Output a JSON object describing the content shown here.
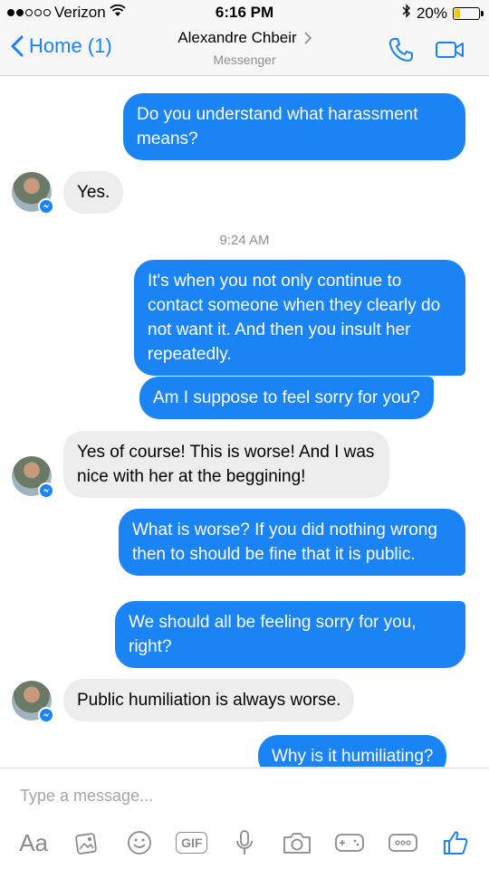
{
  "status_bar": {
    "carrier": "Verizon",
    "time": "6:16 PM",
    "battery": "20%",
    "battery_level": 0.2
  },
  "nav": {
    "back_label": "Home (1)",
    "contact_name": "Alexandre Chbeir",
    "subtitle": "Messenger"
  },
  "messages": [
    {
      "from": "me",
      "text": "Do you understand what harassment means?"
    },
    {
      "from": "them",
      "text": "Yes."
    },
    {
      "type": "timestamp",
      "text": "9:24 AM"
    },
    {
      "from": "me",
      "text": "It's when you not only continue to contact someone when they clearly do not want it.  And then you insult her repeatedly."
    },
    {
      "from": "me",
      "text": "Am I suppose to feel sorry for you?"
    },
    {
      "from": "them",
      "text": "Yes of course! This is worse! And I was nice with her at the beggining!"
    },
    {
      "from": "me",
      "text": "What is worse?  If you did nothing wrong then to should be fine that it is public."
    },
    {
      "from": "me",
      "text": "We should all be feeling sorry for you, right?"
    },
    {
      "from": "them",
      "text": "Public humiliation is always worse."
    },
    {
      "from": "me",
      "text": "Why is it humiliating?"
    }
  ],
  "composer": {
    "placeholder": "Type a message...",
    "aa_label": "Aa",
    "gif_label": "GIF"
  },
  "colors": {
    "accent": "#1783f5",
    "outgoing_bubble": "#1b84f5",
    "incoming_bubble": "#ededed"
  },
  "icons": [
    "wifi-icon",
    "bluetooth-icon",
    "phone-icon",
    "video-icon",
    "photo-icon",
    "emoji-icon",
    "mic-icon",
    "camera-icon",
    "game-icon",
    "more-icon",
    "like-icon"
  ]
}
